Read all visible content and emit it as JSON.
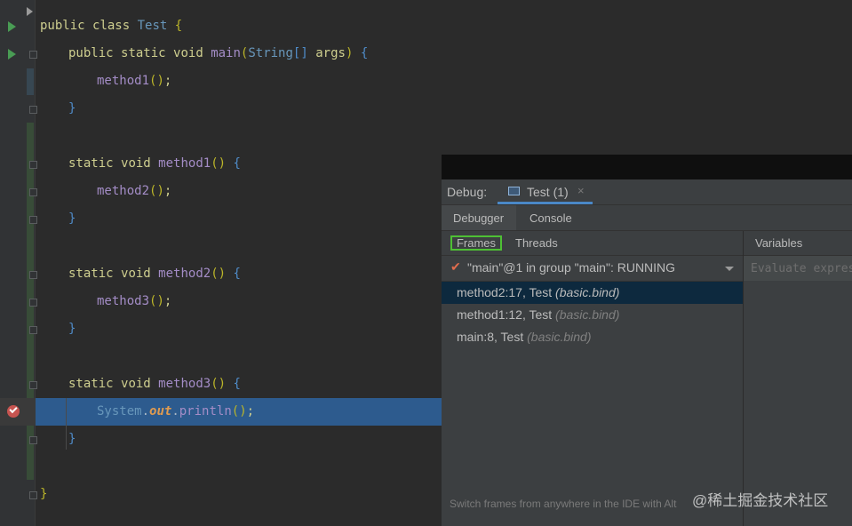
{
  "editor": {
    "code": {
      "line1": {
        "kw1": "public",
        "kw2": "class",
        "cls": "Test",
        "brace": "{"
      },
      "line2": {
        "kw1": "public",
        "kw2": "static",
        "kw3": "void",
        "fn": "main",
        "paren_open": "(",
        "type": "String",
        "arr": "[]",
        "arg": "args",
        "paren_close": ")",
        "brace": "{"
      },
      "line3": {
        "call": "method1",
        "parens": "()",
        "semi": ";"
      },
      "line4": {
        "brace": "}"
      },
      "line6": {
        "kw1": "static",
        "kw2": "void",
        "fn": "method1",
        "parens": "()",
        "brace": "{"
      },
      "line7": {
        "call": "method2",
        "parens": "()",
        "semi": ";"
      },
      "line8": {
        "brace": "}"
      },
      "line10": {
        "kw1": "static",
        "kw2": "void",
        "fn": "method2",
        "parens": "()",
        "brace": "{"
      },
      "line11": {
        "call": "method3",
        "parens": "()",
        "semi": ";"
      },
      "line12": {
        "brace": "}"
      },
      "line14": {
        "kw1": "static",
        "kw2": "void",
        "fn": "method3",
        "parens": "()",
        "brace": "{"
      },
      "line15": {
        "cls": "System",
        "dot1": ".",
        "field": "out",
        "dot2": ".",
        "call": "println",
        "parens": "()",
        "semi": ";"
      },
      "line16": {
        "brace": "}"
      },
      "line18": {
        "brace": "}"
      }
    }
  },
  "debug": {
    "label": "Debug:",
    "session_tab": "Test (1)",
    "session_close": "×",
    "subtabs": {
      "debugger": "Debugger",
      "console": "Console"
    },
    "frames_tab": "Frames",
    "threads_tab": "Threads",
    "thread": {
      "check": "✔",
      "label": "\"main\"@1 in group \"main\": RUNNING"
    },
    "frames": [
      {
        "name": "method2:17, Test ",
        "pkg": "(basic.bind)",
        "selected": true
      },
      {
        "name": "method1:12, Test ",
        "pkg": "(basic.bind)",
        "selected": false
      },
      {
        "name": "main:8, Test ",
        "pkg": "(basic.bind)",
        "selected": false
      }
    ],
    "variables_label": "Variables",
    "evaluate_placeholder": "Evaluate expression",
    "hint": "Switch frames from anywhere in the IDE with Alt"
  },
  "watermark": "@稀土掘金技术社区",
  "colors": {
    "run_icon": "#499c54",
    "breakpoint": "#c75450",
    "exec_line": "#2d5b8e",
    "frames_highlight": "#4ec034"
  }
}
